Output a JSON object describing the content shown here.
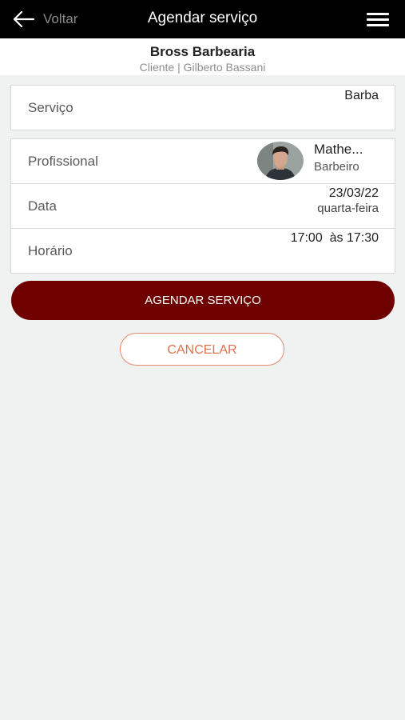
{
  "header": {
    "back_label": "Voltar",
    "title": "Agendar serviço",
    "back_icon": "arrow-left-icon",
    "menu_icon": "hamburger-menu-icon"
  },
  "shop": {
    "name": "Bross Barbearia",
    "subtitle": "Cliente | Gilberto Bassani"
  },
  "service": {
    "label": "Serviço",
    "value": "Barba"
  },
  "professional": {
    "label": "Profissional",
    "name": "Mathe...",
    "role": "Barbeiro"
  },
  "date": {
    "label": "Data",
    "value": "23/03/22",
    "weekday": "quarta-feira"
  },
  "time": {
    "label": "Horário",
    "value": "17:00  às 17:30"
  },
  "actions": {
    "confirm": "AGENDAR SERVIÇO",
    "cancel": "CANCELAR"
  },
  "colors": {
    "topbar": "#000000",
    "primary": "#6e0000",
    "cancel_accent": "#e0704c",
    "background": "#f0f1f1"
  }
}
